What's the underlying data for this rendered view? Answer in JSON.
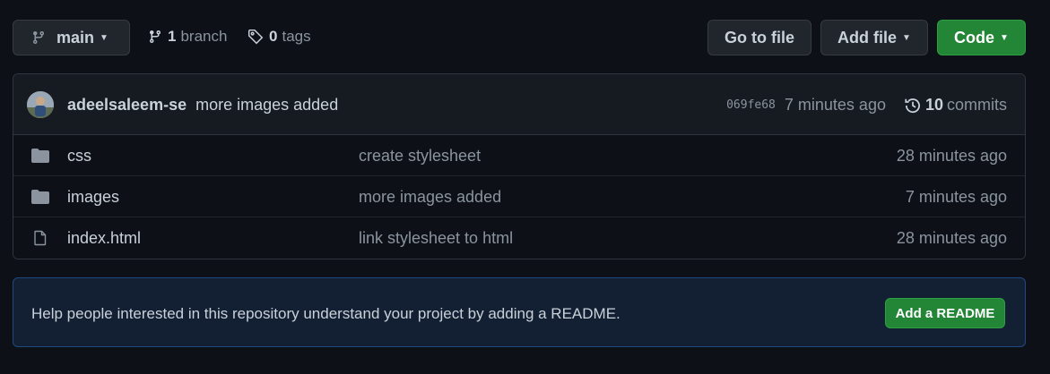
{
  "toolbar": {
    "branch_name": "main",
    "branch_count": "1",
    "branch_label": "branch",
    "tag_count": "0",
    "tag_label": "tags",
    "goto_file_label": "Go to file",
    "add_file_label": "Add file",
    "code_label": "Code"
  },
  "latest_commit": {
    "author": "adeelsaleem-se",
    "message": "more images added",
    "sha": "069fe68",
    "time": "7 minutes ago",
    "commit_count": "10",
    "commits_label": "commits"
  },
  "files": [
    {
      "name": "css",
      "type": "folder",
      "commit_message": "create stylesheet",
      "age": "28 minutes ago"
    },
    {
      "name": "images",
      "type": "folder",
      "commit_message": "more images added",
      "age": "7 minutes ago"
    },
    {
      "name": "index.html",
      "type": "file",
      "commit_message": "link stylesheet to html",
      "age": "28 minutes ago"
    }
  ],
  "readme_prompt": {
    "text": "Help people interested in this repository understand your project by adding a README.",
    "button_label": "Add a README"
  },
  "icons": {
    "branch": "git-branch-icon",
    "tag": "tag-icon",
    "history": "history-icon",
    "folder": "folder-icon",
    "file": "file-icon"
  },
  "colors": {
    "background": "#0d1117",
    "primary_green": "#238636",
    "muted_text": "#8b949e",
    "folder_icon": "#8b949e",
    "readme_border": "#1f4a80"
  }
}
